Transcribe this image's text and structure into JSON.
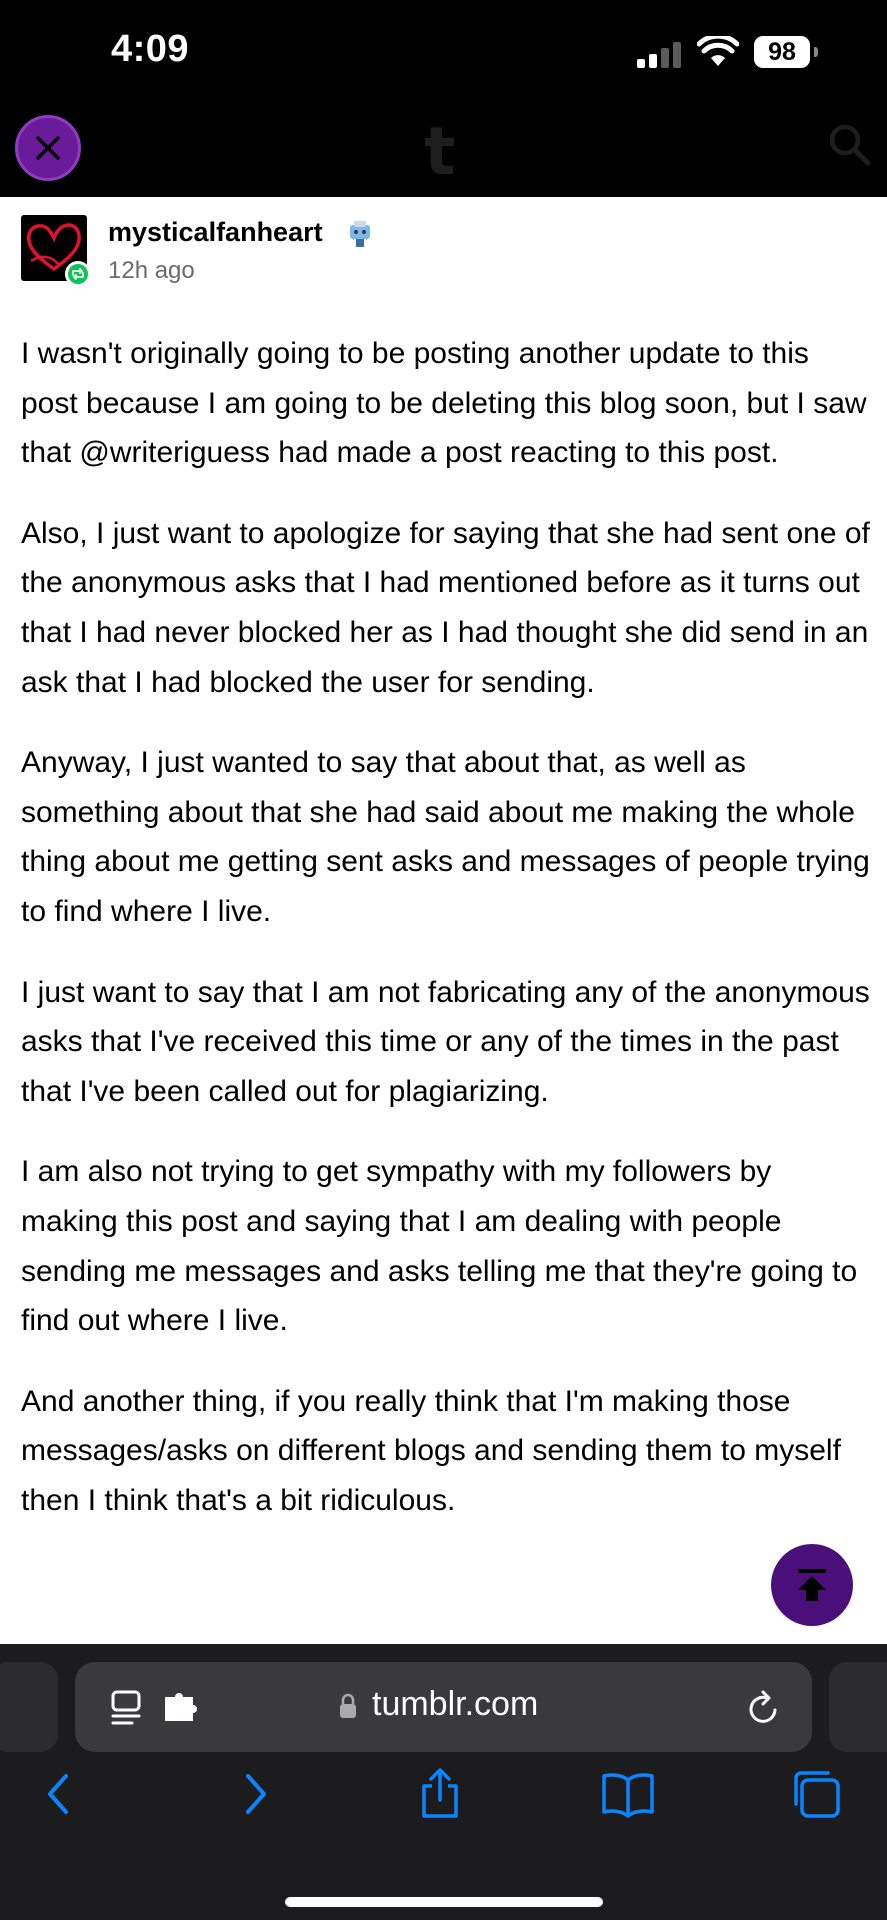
{
  "status_bar": {
    "time": "4:09",
    "battery": "98"
  },
  "app_header": {
    "logo": "t"
  },
  "post": {
    "blog_name": "mysticalfanheart",
    "time_ago": "12h ago",
    "paragraphs": [
      "I wasn't originally going to be posting another update to this post because I am going to be deleting this blog soon, but I saw that @writeriguess had made a post reacting to this post.",
      "Also, I just want to apologize for saying that she had sent one of the anonymous asks that I had mentioned before as it turns out that I had never blocked her as I had thought she did send in an ask that I had blocked the user for sending.",
      "Anyway, I just wanted to say that about that, as well as something about that she had said about me making the whole thing about me getting sent asks and messages of people trying to find where I live.",
      "I just want to say that I am not fabricating any of the anonymous asks that I've received this time or any of the times in the past that I've been called out for plagiarizing.",
      "I am also not trying to get sympathy with my followers by making this post and saying that I am dealing with people sending me messages and asks telling me that they're going to find out where I live.",
      "And another thing, if you really think that I'm making those messages/asks on different blogs and sending them to myself then I think that's a bit ridiculous."
    ]
  },
  "browser": {
    "url": "tumblr.com"
  },
  "colors": {
    "close_button": "#6a1b9a",
    "reblog_badge": "#0cc35a",
    "scroll_top_button": "#4b0f7a",
    "safari_blue": "#0a84ff"
  },
  "icons": [
    "close-icon",
    "search-icon",
    "reblog-icon",
    "scroll-to-top-icon",
    "reader-icon",
    "extension-icon",
    "lock-icon",
    "reload-icon",
    "back-icon",
    "forward-icon",
    "share-icon",
    "bookmarks-icon",
    "tabs-icon"
  ]
}
